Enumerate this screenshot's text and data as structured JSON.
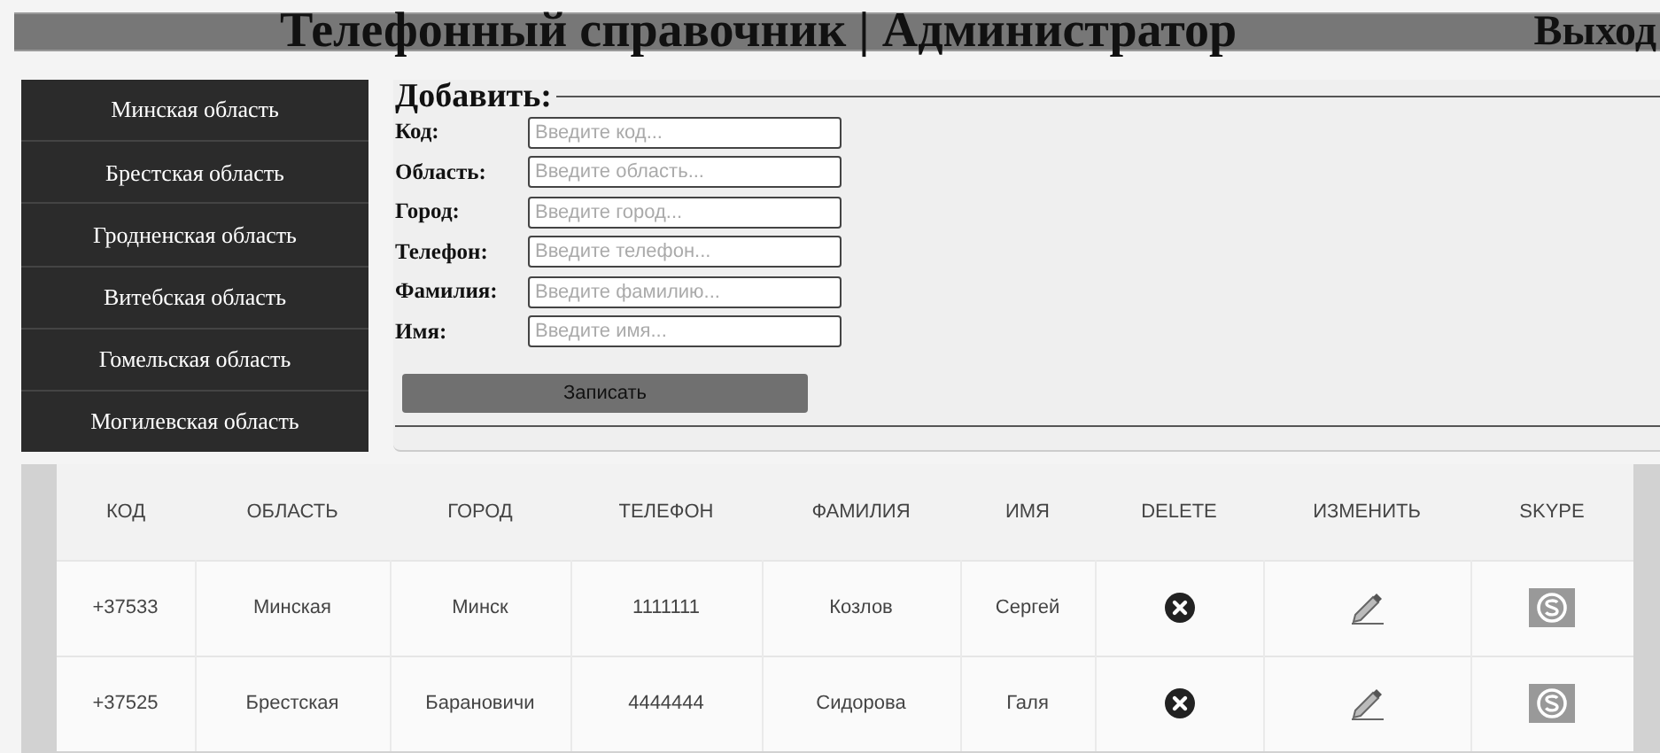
{
  "header": {
    "title": "Телефонный справочник | Администратор",
    "logout": "Выход"
  },
  "sidebar": {
    "items": [
      {
        "label": "Минская область"
      },
      {
        "label": "Брестская область"
      },
      {
        "label": "Гродненская область"
      },
      {
        "label": "Витебская область"
      },
      {
        "label": "Гомельская область"
      },
      {
        "label": "Могилевская область"
      }
    ]
  },
  "form": {
    "legend": "Добавить:",
    "fields": [
      {
        "label": "Код:",
        "placeholder": "Введите код..."
      },
      {
        "label": "Область:",
        "placeholder": "Введите область..."
      },
      {
        "label": "Город:",
        "placeholder": "Введите город..."
      },
      {
        "label": "Телефон:",
        "placeholder": "Введите телефон..."
      },
      {
        "label": "Фамилия:",
        "placeholder": "Введите фамилию..."
      },
      {
        "label": "Имя:",
        "placeholder": "Введите имя..."
      }
    ],
    "submit": "Записать"
  },
  "table": {
    "columns": [
      "КОД",
      "ОБЛАСТЬ",
      "ГОРОД",
      "ТЕЛЕФОН",
      "ФАМИЛИЯ",
      "ИМЯ",
      "DELETE",
      "ИЗМЕНИТЬ",
      "SKYPE"
    ],
    "rows": [
      {
        "cells": [
          "+37533",
          "Минская",
          "Минск",
          "1111111",
          "Козлов",
          "Сергей"
        ]
      },
      {
        "cells": [
          "+37525",
          "Брестская",
          "Барановичи",
          "4444444",
          "Сидорова",
          "Галя"
        ]
      }
    ]
  }
}
